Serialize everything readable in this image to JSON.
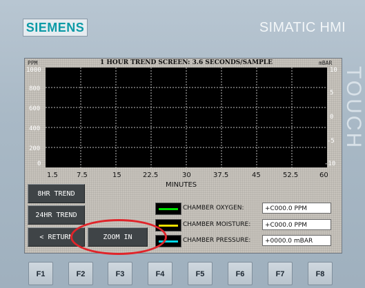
{
  "device": {
    "brand": "SIEMENS",
    "model": "SIMATIC HMI",
    "side_label": "TOUCH"
  },
  "screen": {
    "title": "1 HOUR TREND SCREEN: 3.6 SECONDS/SAMPLE",
    "left_unit": "PPM",
    "right_unit": "mBAR",
    "y_left_ticks": [
      "1000",
      "800",
      "600",
      "400",
      "200",
      "0"
    ],
    "y_right_ticks": [
      "10",
      "5",
      "0",
      "-5",
      "-10"
    ],
    "x_ticks": [
      "1.5",
      "7.5",
      "15",
      "22.5",
      "30",
      "37.5",
      "45",
      "52.5",
      "60"
    ],
    "x_label": "MINUTES"
  },
  "buttons": {
    "trend_8hr": "8HR TREND",
    "trend_24hr": "24HR TREND",
    "return": "< RETURN",
    "zoom_in": "ZOOM IN"
  },
  "legend": [
    {
      "label": "CHAMBER OXYGEN:",
      "value": "+C000.0 PPM",
      "color": "#00e000"
    },
    {
      "label": "CHAMBER MOISTURE:",
      "value": "+C000.0 PPM",
      "color": "#f0e000"
    },
    {
      "label": "CHAMBER PRESSURE:",
      "value": "+0000.0 mBAR",
      "color": "#00d8e8"
    }
  ],
  "fkeys": [
    "F1",
    "F2",
    "F3",
    "F4",
    "F5",
    "F6",
    "F7",
    "F8"
  ]
}
